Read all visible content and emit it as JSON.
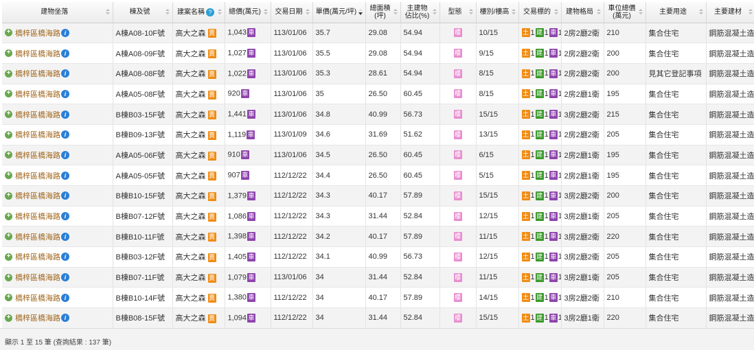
{
  "headers": {
    "address": "建物坐落",
    "building": "棟及號",
    "project": "建案名稱",
    "total_price": "總價(萬元)",
    "date": "交易日期",
    "unit_price": "單價(萬元/坪)",
    "area_line1": "總面積",
    "area_line2": "(坪)",
    "ratio_line1": "主建物",
    "ratio_line2": "佔比(%)",
    "type": "型態",
    "floor": "樓別/樓高",
    "deal": "交易標的",
    "layout": "建物格局",
    "parking_line1": "車位總價",
    "parking_line2": "(萬元)",
    "usage": "主要用途",
    "material": "主要建材"
  },
  "badges": {
    "sell": "賣",
    "car": "車",
    "type": "樓",
    "land": "土",
    "bldg": "建",
    "park": "車"
  },
  "rows": [
    {
      "address": "橋梓區橋海路",
      "building": "A棟A08-10F號",
      "project": "高大之森",
      "total": "1,043",
      "date": "113/01/06",
      "unit": "35.7",
      "area": "29.08",
      "ratio": "54.94",
      "floor": "10/15",
      "land": "1",
      "bldg": "1",
      "park": "1",
      "layout": "2房2廳2衛",
      "parking": "210",
      "usage": "集合住宅",
      "material": "鋼筋混凝土造"
    },
    {
      "address": "橋梓區橋海路",
      "building": "A棟A08-09F號",
      "project": "高大之森",
      "total": "1,027",
      "date": "113/01/06",
      "unit": "35.5",
      "area": "29.08",
      "ratio": "54.94",
      "floor": "9/15",
      "land": "1",
      "bldg": "1",
      "park": "1",
      "layout": "2房2廳2衛",
      "parking": "200",
      "usage": "集合住宅",
      "material": "鋼筋混凝土造"
    },
    {
      "address": "橋梓區橋海路",
      "building": "A棟A08-08F號",
      "project": "高大之森",
      "total": "1,022",
      "date": "113/01/06",
      "unit": "35.3",
      "area": "28.61",
      "ratio": "54.94",
      "floor": "8/15",
      "land": "1",
      "bldg": "1",
      "park": "1",
      "layout": "2房2廳2衛",
      "parking": "200",
      "usage": "見其它登記事項",
      "material": "鋼筋混凝土造"
    },
    {
      "address": "橋梓區橋海路",
      "building": "A棟A05-08F號",
      "project": "高大之森",
      "total": "920",
      "date": "113/01/06",
      "unit": "35",
      "area": "26.50",
      "ratio": "60.45",
      "floor": "8/15",
      "land": "1",
      "bldg": "1",
      "park": "1",
      "layout": "2房2廳1衛",
      "parking": "195",
      "usage": "集合住宅",
      "material": "鋼筋混凝土造"
    },
    {
      "address": "橋梓區橋海路",
      "building": "B棟B03-15F號",
      "project": "高大之森",
      "total": "1,441",
      "date": "113/01/06",
      "unit": "34.8",
      "area": "40.99",
      "ratio": "56.73",
      "floor": "15/15",
      "land": "1",
      "bldg": "1",
      "park": "1",
      "layout": "3房2廳2衛",
      "parking": "215",
      "usage": "集合住宅",
      "material": "鋼筋混凝土造"
    },
    {
      "address": "橋梓區橋海路",
      "building": "B棟B09-13F號",
      "project": "高大之森",
      "total": "1,119",
      "date": "113/01/09",
      "unit": "34.6",
      "area": "31.69",
      "ratio": "51.62",
      "floor": "13/15",
      "land": "1",
      "bldg": "1",
      "park": "1",
      "layout": "2房2廳2衛",
      "parking": "205",
      "usage": "集合住宅",
      "material": "鋼筋混凝土造"
    },
    {
      "address": "橋梓區橋海路",
      "building": "A棟A05-06F號",
      "project": "高大之森",
      "total": "910",
      "date": "113/01/06",
      "unit": "34.5",
      "area": "26.50",
      "ratio": "60.45",
      "floor": "6/15",
      "land": "1",
      "bldg": "1",
      "park": "1",
      "layout": "2房2廳1衛",
      "parking": "195",
      "usage": "集合住宅",
      "material": "鋼筋混凝土造"
    },
    {
      "address": "橋梓區橋海路",
      "building": "A棟A05-05F號",
      "project": "高大之森",
      "total": "907",
      "date": "112/12/22",
      "unit": "34.4",
      "area": "26.50",
      "ratio": "60.45",
      "floor": "5/15",
      "land": "1",
      "bldg": "1",
      "park": "1",
      "layout": "2房2廳1衛",
      "parking": "195",
      "usage": "集合住宅",
      "material": "鋼筋混凝土造"
    },
    {
      "address": "橋梓區橋海路",
      "building": "B棟B10-15F號",
      "project": "高大之森",
      "total": "1,379",
      "date": "112/12/22",
      "unit": "34.3",
      "area": "40.17",
      "ratio": "57.89",
      "floor": "15/15",
      "land": "1",
      "bldg": "1",
      "park": "1",
      "layout": "3房2廳2衛",
      "parking": "200",
      "usage": "集合住宅",
      "material": "鋼筋混凝土造"
    },
    {
      "address": "橋梓區橋海路",
      "building": "B棟B07-12F號",
      "project": "高大之森",
      "total": "1,086",
      "date": "112/12/22",
      "unit": "34.3",
      "area": "31.44",
      "ratio": "52.84",
      "floor": "12/15",
      "land": "1",
      "bldg": "1",
      "park": "1",
      "layout": "3房2廳1衛",
      "parking": "205",
      "usage": "集合住宅",
      "material": "鋼筋混凝土造"
    },
    {
      "address": "橋梓區橋海路",
      "building": "B棟B10-11F號",
      "project": "高大之森",
      "total": "1,398",
      "date": "112/12/22",
      "unit": "34.2",
      "area": "40.17",
      "ratio": "57.89",
      "floor": "11/15",
      "land": "1",
      "bldg": "1",
      "park": "1",
      "layout": "3房2廳2衛",
      "parking": "220",
      "usage": "集合住宅",
      "material": "鋼筋混凝土造"
    },
    {
      "address": "橋梓區橋海路",
      "building": "B棟B03-12F號",
      "project": "高大之森",
      "total": "1,405",
      "date": "112/12/22",
      "unit": "34.1",
      "area": "40.99",
      "ratio": "56.73",
      "floor": "12/15",
      "land": "1",
      "bldg": "1",
      "park": "1",
      "layout": "3房2廳2衛",
      "parking": "205",
      "usage": "集合住宅",
      "material": "鋼筋混凝土造"
    },
    {
      "address": "橋梓區橋海路",
      "building": "B棟B07-11F號",
      "project": "高大之森",
      "total": "1,079",
      "date": "113/01/06",
      "unit": "34",
      "area": "31.44",
      "ratio": "52.84",
      "floor": "11/15",
      "land": "1",
      "bldg": "1",
      "park": "1",
      "layout": "3房2廳1衛",
      "parking": "205",
      "usage": "集合住宅",
      "material": "鋼筋混凝土造"
    },
    {
      "address": "橋梓區橋海路",
      "building": "B棟B10-14F號",
      "project": "高大之森",
      "total": "1,380",
      "date": "112/12/22",
      "unit": "34",
      "area": "40.17",
      "ratio": "57.89",
      "floor": "14/15",
      "land": "1",
      "bldg": "1",
      "park": "1",
      "layout": "3房2廳2衛",
      "parking": "210",
      "usage": "集合住宅",
      "material": "鋼筋混凝土造"
    },
    {
      "address": "橋梓區橋海路",
      "building": "B棟B08-15F號",
      "project": "高大之森",
      "total": "1,094",
      "date": "112/12/22",
      "unit": "34",
      "area": "31.44",
      "ratio": "52.84",
      "floor": "15/15",
      "land": "1",
      "bldg": "1",
      "park": "1",
      "layout": "3房2廳1衛",
      "parking": "220",
      "usage": "集合住宅",
      "material": "鋼筋混凝土造"
    }
  ],
  "footer": {
    "text": "顯示 1 至 15 筆 (查詢結果 : 137 筆)"
  },
  "colors": {
    "address_text": "#a0661c",
    "sell_badge": "#f08c14",
    "car_badge": "#8e44ad",
    "type_badge": "#e88ecf",
    "land_badge": "#f08c14",
    "bldg_badge": "#3a9a2a",
    "park_badge": "#8e44ad",
    "row_stripe": "#f3f3f3"
  },
  "icons": {
    "expand": "plus-circle-icon",
    "info": "info-icon",
    "help": "question-icon"
  }
}
